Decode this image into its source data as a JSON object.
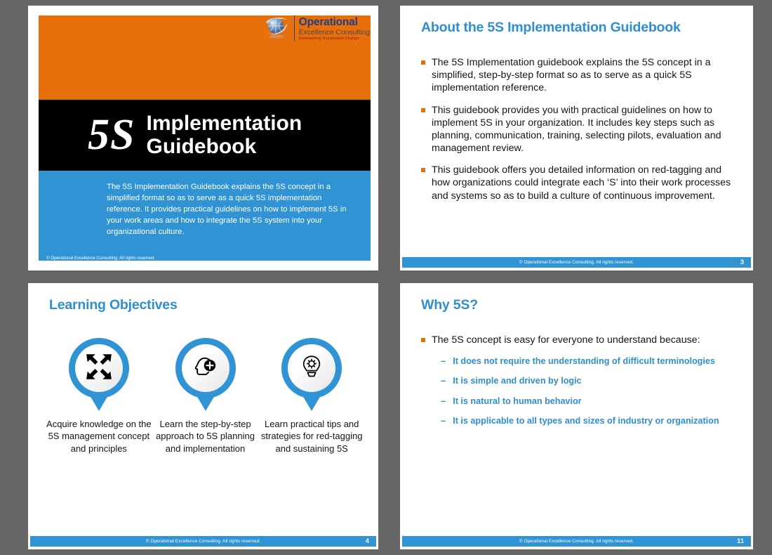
{
  "brand": {
    "accent_blue": "#3093D3",
    "title_blue": "#2F8ED0",
    "orange": "#E8700A",
    "black": "#000000",
    "backdrop_gray": "#666666",
    "logo_name": "Operational",
    "logo_sub": "Excellence Consulting",
    "logo_tagline": "Empowering Sustainable Change"
  },
  "slides": [
    {
      "kind": "title",
      "five_s": "5S",
      "title_lines": [
        "Implementation",
        "Guidebook"
      ],
      "body": "The 5S Implementation Guidebook explains the 5S concept in a simplified format so as to serve as a quick 5S implementation reference. It provides practical guidelines on how to implement 5S in your work areas and how to integrate the 5S system into your organizational culture.",
      "footer_copy": "© Operational Excellence Consulting.  All rights reserved."
    },
    {
      "kind": "bullets",
      "title": "About the 5S Implementation Guidebook",
      "bullets": [
        "The 5S Implementation guidebook explains the 5S concept in a simplified, step-by-step format so as to serve as a quick 5S implementation reference.",
        "This guidebook provides you with practical guidelines on how to implement 5S in your organization. It includes key steps such as planning, communication, training, selecting pilots, evaluation and management review.",
        "This guidebook offers you detailed information on red-tagging and how organizations could integrate each ‘S’ into their work processes and systems so as to build a culture of continuous improvement."
      ],
      "footer_copy": "© Operational Excellence Consulting.  All rights reserved.",
      "page_number": "3"
    },
    {
      "kind": "pins",
      "title": "Learning Objectives",
      "pins": [
        {
          "icon": "arrows-converge-icon",
          "caption": "Acquire knowledge on the 5S management concept and principles"
        },
        {
          "icon": "head-plus-icon",
          "caption": "Learn the step-by-step approach to 5S planning and implementation"
        },
        {
          "icon": "lightbulb-gear-icon",
          "caption": "Learn practical tips and strategies for red-tagging and sustaining 5S"
        }
      ],
      "footer_copy": "© Operational Excellence Consulting.  All rights reserved.",
      "page_number": "4"
    },
    {
      "kind": "bullets-sub",
      "title": "Why 5S?",
      "lead_bullet": "The 5S concept is easy for everyone to understand because:",
      "sub_bullets": [
        "It does not require the understanding of difficult terminologies",
        "It is simple and driven by logic",
        "It is natural to human behavior",
        "It is applicable to all types and sizes of industry or organization"
      ],
      "footer_copy": "© Operational Excellence Consulting.  All rights reserved.",
      "page_number": "11"
    }
  ]
}
